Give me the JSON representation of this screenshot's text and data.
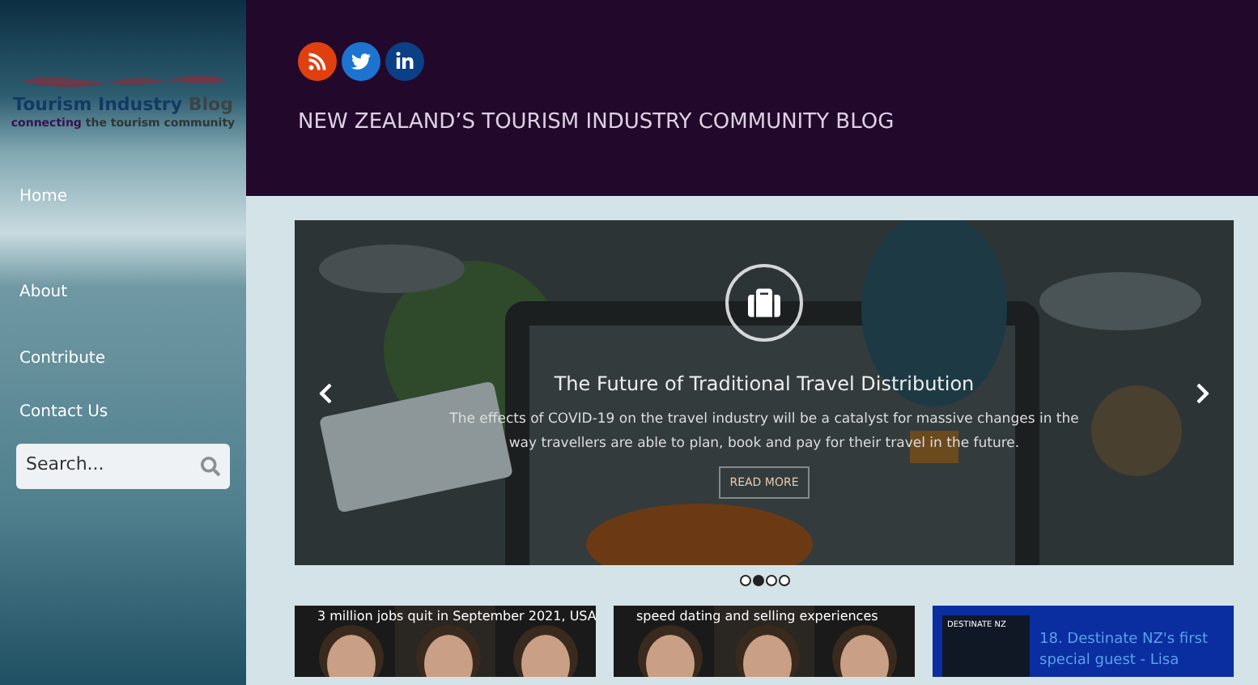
{
  "logo": {
    "name": "Tourism Industry",
    "name_suffix": "Blog",
    "tagline": "connecting",
    "tagline_suffix": "the tourism community"
  },
  "nav": [
    {
      "label": "Home"
    },
    {
      "label": "About"
    },
    {
      "label": "Contribute"
    },
    {
      "label": "Contact Us"
    }
  ],
  "search": {
    "placeholder": "Search..."
  },
  "social": [
    {
      "kind": "rss"
    },
    {
      "kind": "twitter"
    },
    {
      "kind": "linkedin"
    }
  ],
  "tagline": "NEW ZEALAND’S TOURISM INDUSTRY COMMUNITY BLOG",
  "slide": {
    "title": "The Future of Traditional Travel Distribution",
    "text": "The effects of COVID-19 on the travel industry will be a catalyst for massive changes in the way travellers are able to plan, book and pay for their travel in the future.",
    "button": "READ MORE"
  },
  "dots": [
    {
      "selected": false
    },
    {
      "selected": true
    },
    {
      "selected": false
    },
    {
      "selected": false
    }
  ],
  "cards": [
    {
      "kind": "video",
      "title": "3 million jobs quit in September 2021, USA"
    },
    {
      "kind": "video",
      "title": "speed dating and selling experiences"
    },
    {
      "kind": "podcast",
      "brand": "DESTINATE NZ",
      "title": "18. Destinate NZ's first special guest - Lisa"
    }
  ]
}
